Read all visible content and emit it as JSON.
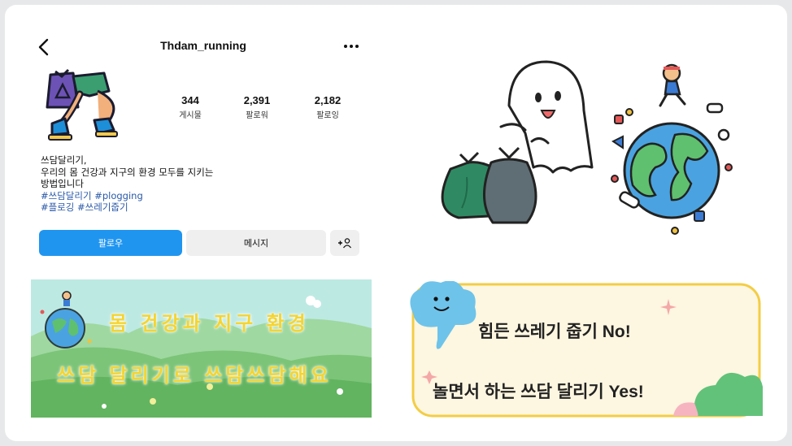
{
  "profile": {
    "username": "Thdam_running",
    "stats": [
      {
        "value": "344",
        "label": "게시물"
      },
      {
        "value": "2,391",
        "label": "팔로워"
      },
      {
        "value": "2,182",
        "label": "팔로잉"
      }
    ],
    "bio": {
      "line1": "쓰담달리기,",
      "line2": "우리의 몸 건강과 지구의 환경 모두를 지키는",
      "line3": "방법입니다",
      "hashtags1": "#쓰담달리기 #plogging",
      "hashtags2": "#플로깅 #쓰레기줍기"
    },
    "buttons": {
      "follow": "팔로우",
      "message": "메시지",
      "add_user": "+👤"
    }
  },
  "banner_left": {
    "line1": "몸 건강과 지구 환경",
    "line2": "쓰담 달리기로 쓰담쓰담해요"
  },
  "banner_right": {
    "line1": "힘든 쓰레기 줍기 No!",
    "line2": "놀면서 하는 쓰담 달리기 Yes!"
  },
  "colors": {
    "follow_button": "#1f95f0",
    "hashtag": "#2a59a9",
    "banner_text": "#f5d431",
    "bubble_border": "#f3cd45",
    "bubble_fill": "#fdf6e0"
  }
}
